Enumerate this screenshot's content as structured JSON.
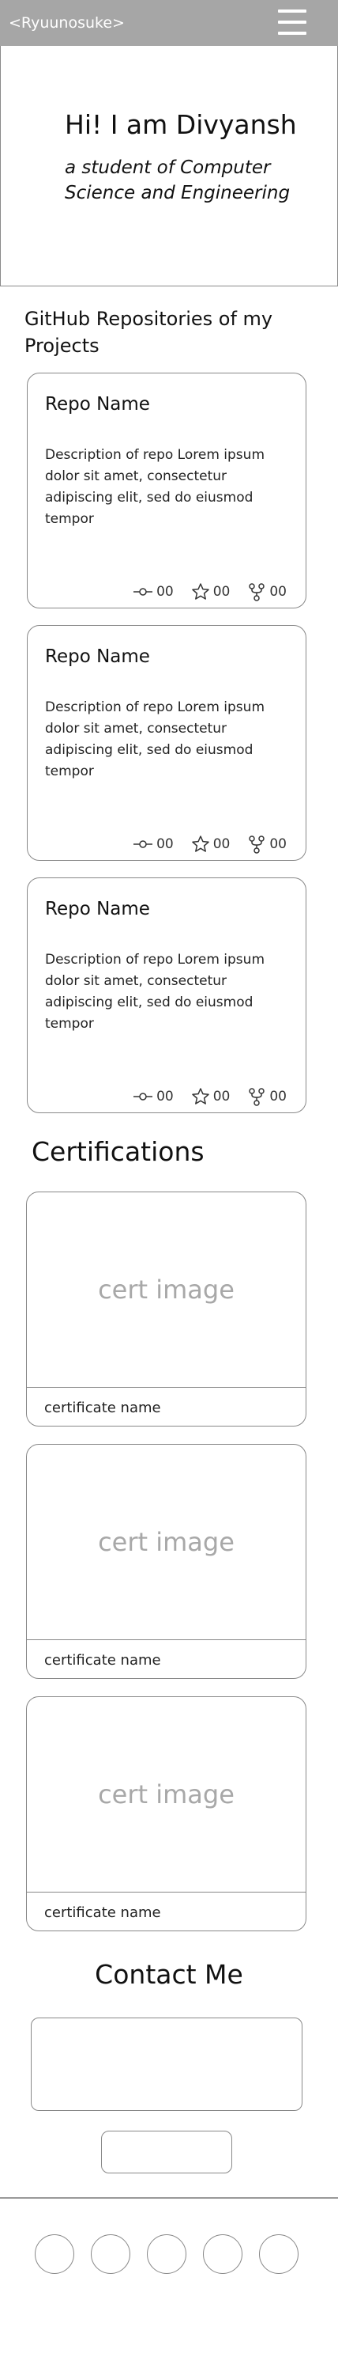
{
  "navbar": {
    "brand": "<Ryuunosuke>"
  },
  "hero": {
    "title": "Hi! I am Divyansh",
    "subtitle": "a student of Computer Science and Engineering"
  },
  "repos_section": {
    "title": "GitHub Repositories of my Projects",
    "repos": [
      {
        "name": "Repo Name",
        "description": "Description of repo Lorem ipsum dolor sit amet, consectetur adipiscing elit, sed do eiusmod tempor",
        "commits": "00",
        "stars": "00",
        "forks": "00"
      },
      {
        "name": "Repo Name",
        "description": "Description of repo Lorem ipsum dolor sit amet, consectetur adipiscing elit, sed do eiusmod tempor",
        "commits": "00",
        "stars": "00",
        "forks": "00"
      },
      {
        "name": "Repo Name",
        "description": "Description of repo Lorem ipsum dolor sit amet, consectetur adipiscing elit, sed do eiusmod tempor",
        "commits": "00",
        "stars": "00",
        "forks": "00"
      }
    ]
  },
  "certifications": {
    "title": "Certifications",
    "items": [
      {
        "image_label": "cert image",
        "name": "certificate name"
      },
      {
        "image_label": "cert image",
        "name": "certificate name"
      },
      {
        "image_label": "cert image",
        "name": "certificate name"
      }
    ]
  },
  "contact": {
    "title": "Contact Me"
  },
  "icons": {
    "menu": "hamburger-menu-icon",
    "commits": "commit-icon",
    "stars": "star-icon",
    "forks": "fork-icon"
  },
  "colors": {
    "navbar": "#a6a6a6",
    "border": "#888888",
    "placeholder_text": "#a8a8a8"
  }
}
